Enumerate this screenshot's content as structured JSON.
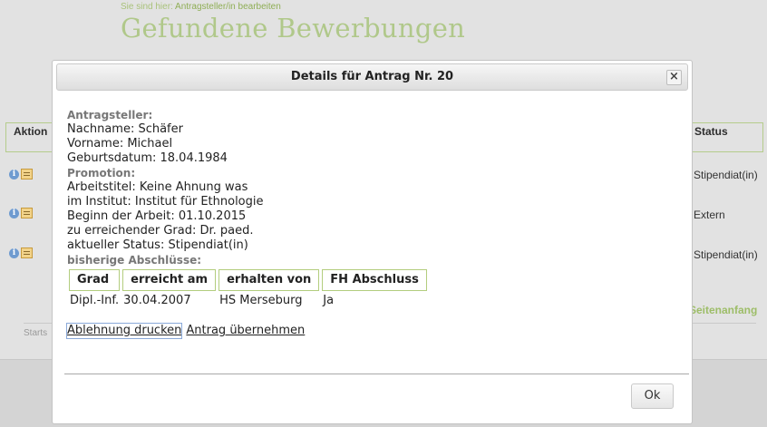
{
  "page": {
    "breadcrumb_prefix": "Sie sind hier:",
    "breadcrumb_link": "Antragsteller/in bearbeiten",
    "title": "Gefundene Bewerbungen",
    "col_aktion": "Aktion",
    "col_status": "Status",
    "rows": [
      {
        "status": "Stipendiat(in)"
      },
      {
        "status": "Extern"
      },
      {
        "status": "Stipendiat(in)"
      }
    ],
    "top_link": "Seitenanfang",
    "footer": "Starts"
  },
  "dialog": {
    "title": "Details für Antrag Nr. 20",
    "close_icon": "×",
    "antragsteller": {
      "heading": "Antragsteller:",
      "nachname": "Nachname: Schäfer",
      "vorname": "Vorname: Michael",
      "geburtsdatum": "Geburtsdatum: 18.04.1984"
    },
    "promotion": {
      "heading": "Promotion:",
      "arbeitstitel": "Arbeitstitel: Keine Ahnung was",
      "institut": "im Institut: Institut für Ethnologie",
      "beginn": "Beginn der Arbeit: 01.10.2015",
      "grad": "zu erreichender Grad: Dr. paed.",
      "status": "aktueller Status: Stipendiat(in)"
    },
    "abschluesse": {
      "heading": "bisherige Abschlüsse:",
      "headers": [
        "Grad",
        "erreicht am",
        "erhalten von",
        "FH Abschluss"
      ],
      "rows": [
        [
          "Dipl.-Inf.",
          "30.04.2007",
          "HS Merseburg",
          "Ja"
        ]
      ]
    },
    "actions": {
      "ablehnung": "Ablehnung drucken",
      "uebernehmen": "Antrag übernehmen"
    },
    "ok_label": "Ok"
  },
  "colors": {
    "accent_green": "#b0c88a",
    "table_border": "#b3cd7e"
  }
}
